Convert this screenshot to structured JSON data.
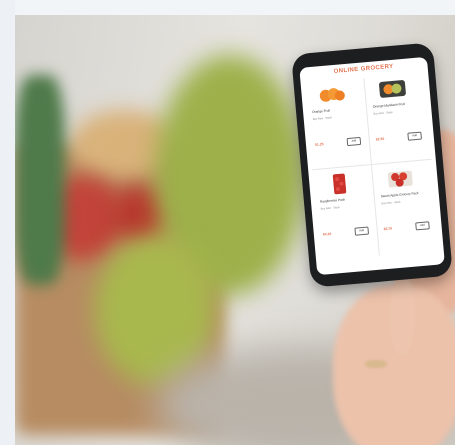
{
  "phone_app": {
    "title": "ONLINE GROCERY",
    "products": [
      {
        "name": "Orange Fruit",
        "detail": "Buy Now · Stock",
        "price": "$1.25",
        "action": "Add"
      },
      {
        "name": "Orange Mandarin Fruit",
        "detail": "Buy Now · Stock",
        "price": "$2.50",
        "action": "Add"
      },
      {
        "name": "Raspberries Pack",
        "detail": "Buy Now · Stock",
        "price": "$4.10",
        "action": "Add"
      },
      {
        "name": "Sweet Apple Grocery Pack",
        "detail": "Buy Now · Stock",
        "price": "$3.70",
        "action": "Add"
      }
    ]
  },
  "colors": {
    "accent": "#e2734f",
    "produce_red": "#d0372d",
    "produce_orange": "#f08a2a"
  },
  "scene": {
    "objects": [
      "grocery-bag-icon",
      "celery-icon",
      "smartphone-icon",
      "hand-icon"
    ]
  }
}
